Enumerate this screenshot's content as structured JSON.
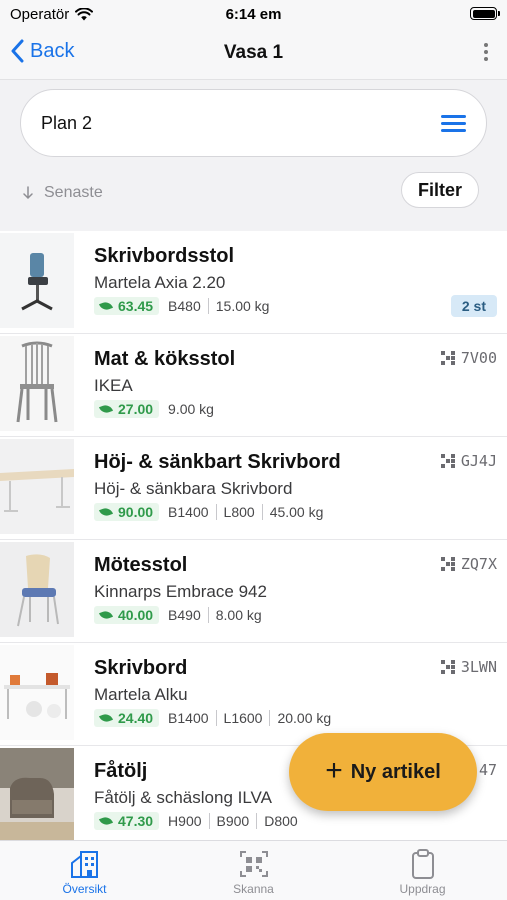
{
  "status_bar": {
    "carrier": "Operatör",
    "time": "6:14 em"
  },
  "nav": {
    "back_label": "Back",
    "title": "Vasa 1"
  },
  "plan": {
    "selected": "Plan 2"
  },
  "sort": {
    "label": "Senaste"
  },
  "filter": {
    "label": "Filter"
  },
  "items": [
    {
      "title": "Skrivbordsstol",
      "subtitle": "Martela Axia 2.20",
      "price": "63.45",
      "dims": [
        "B480",
        "15.00 kg"
      ],
      "badge": "2 st",
      "code": ""
    },
    {
      "title": "Mat & köksstol",
      "subtitle": "IKEA",
      "price": "27.00",
      "dims": [
        "9.00 kg"
      ],
      "badge": "",
      "code": "7V00"
    },
    {
      "title": "Höj- & sänkbart Skrivbord",
      "subtitle": "Höj- & sänkbara Skrivbord",
      "price": "90.00",
      "dims": [
        "B1400",
        "L800",
        "45.00 kg"
      ],
      "badge": "",
      "code": "GJ4J"
    },
    {
      "title": "Mötesstol",
      "subtitle": "Kinnarps Embrace 942",
      "price": "40.00",
      "dims": [
        "B490",
        "8.00 kg"
      ],
      "badge": "",
      "code": "ZQ7X"
    },
    {
      "title": "Skrivbord",
      "subtitle": "Martela Alku",
      "price": "24.40",
      "dims": [
        "B1400",
        "L1600",
        "20.00 kg"
      ],
      "badge": "",
      "code": "3LWN"
    },
    {
      "title": "Fåtölj",
      "subtitle": "Fåtölj & schäslong ILVA",
      "price": "47.30",
      "dims": [
        "H900",
        "B900",
        "D800"
      ],
      "badge": "",
      "code": "47"
    }
  ],
  "fab": {
    "label": "Ny artikel"
  },
  "tabs": [
    {
      "label": "Översikt",
      "icon": "building-icon"
    },
    {
      "label": "Skanna",
      "icon": "qr-scan-icon"
    },
    {
      "label": "Uppdrag",
      "icon": "clipboard-icon"
    }
  ],
  "colors": {
    "accent": "#1a73e8",
    "fab": "#f1b13a",
    "price_green": "#2f9a4a",
    "badge_bg": "#d7e9f7"
  }
}
